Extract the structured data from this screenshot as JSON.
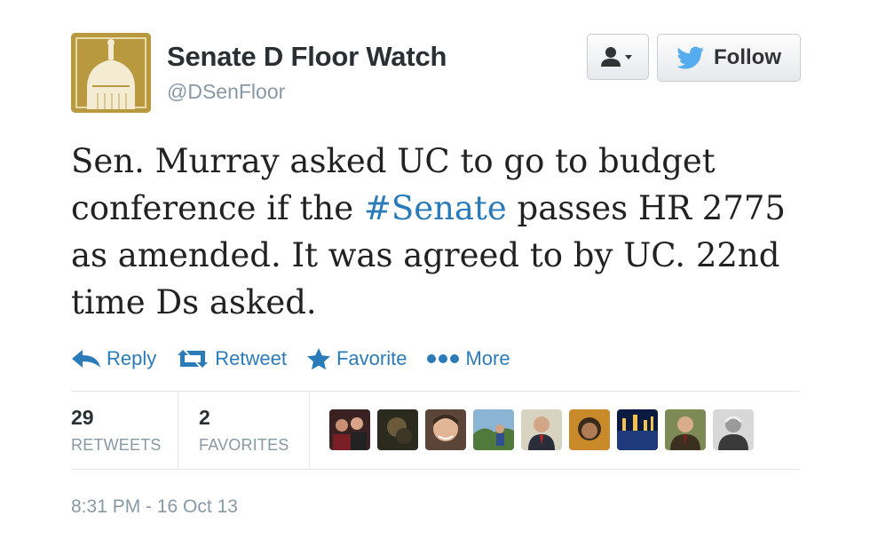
{
  "user": {
    "name": "Senate D Floor Watch",
    "handle": "@DSenFloor"
  },
  "buttons": {
    "follow_label": "Follow"
  },
  "tweet": {
    "text_part1": "Sen. Murray asked UC to go to budget conference if the ",
    "hashtag": "#Senate",
    "text_part2": " passes HR 2775 as amended. It was agreed to by UC. 22nd time Ds asked."
  },
  "actions": {
    "reply": "Reply",
    "retweet": "Retweet",
    "favorite": "Favorite",
    "more": "More"
  },
  "stats": {
    "retweets_count": "29",
    "retweets_label": "RETWEETS",
    "favorites_count": "2",
    "favorites_label": "FAVORITES"
  },
  "timestamp": "8:31 PM - 16 Oct 13",
  "colors": {
    "link": "#2b7bb9",
    "twitter_bird": "#55acee",
    "muted": "#8899a6",
    "avatar_gold": "#b8993f"
  },
  "icons": [
    "capitol-dome-icon",
    "user-icon",
    "caret-down-icon",
    "twitter-bird-icon",
    "reply-icon",
    "retweet-icon",
    "star-icon",
    "more-dots-icon"
  ]
}
